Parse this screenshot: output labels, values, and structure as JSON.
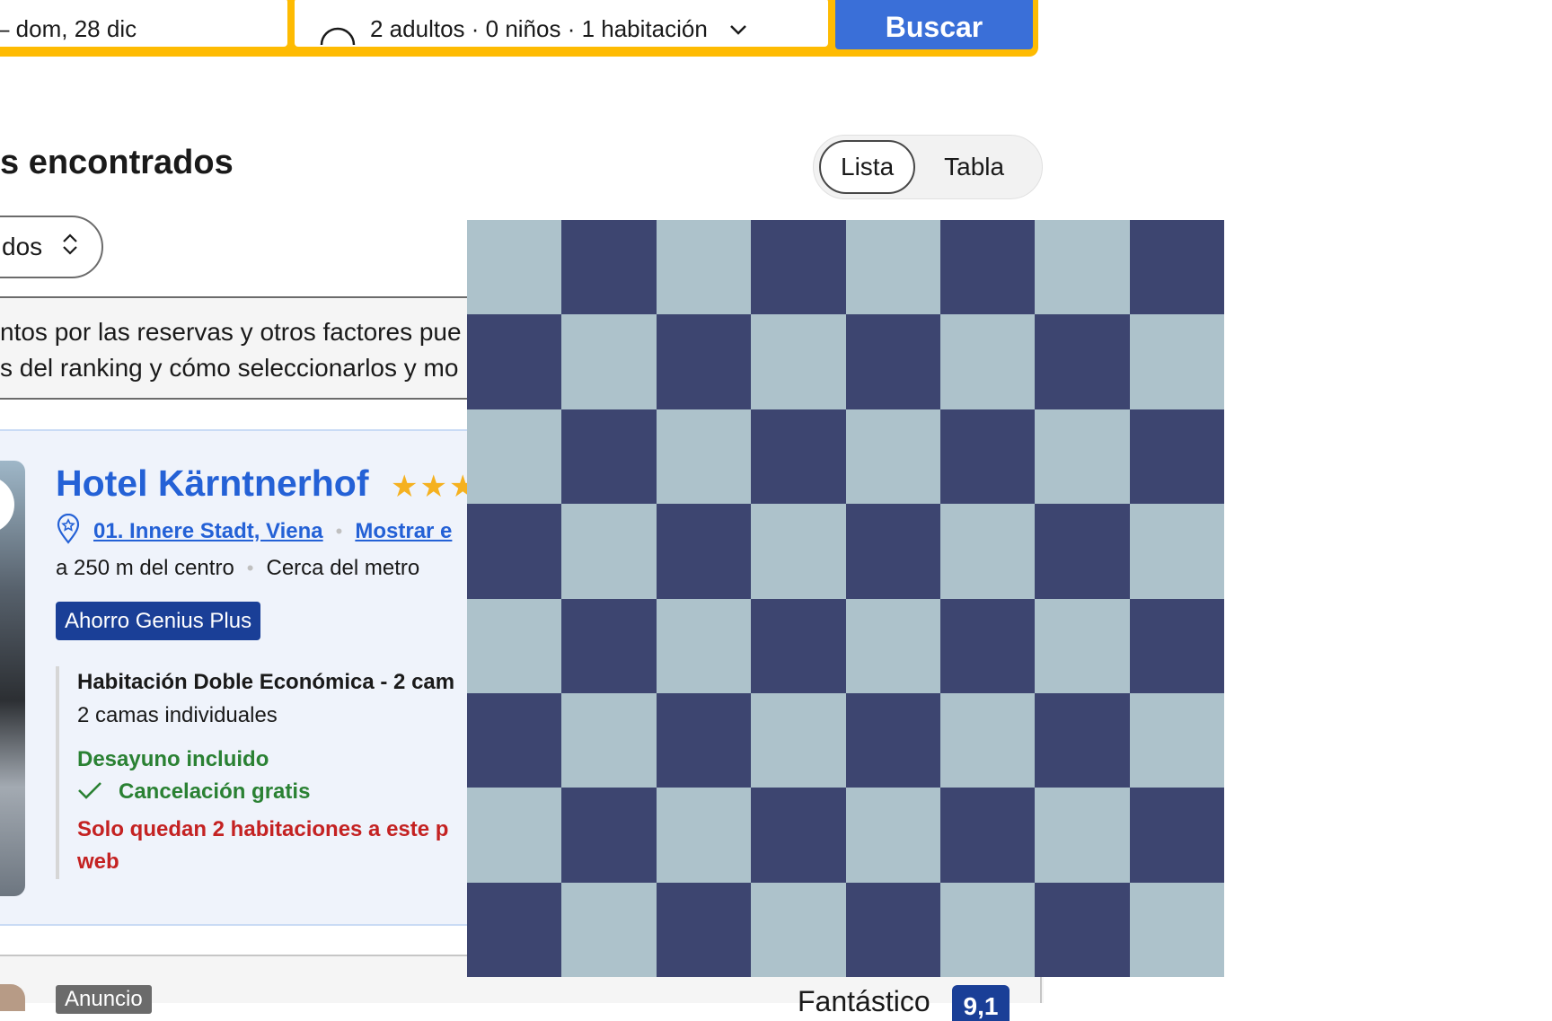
{
  "search": {
    "dates_value": "– dom, 28 dic",
    "guests_value": "2 adultos · 0 niños · 1 habitación",
    "search_button": "Buscar"
  },
  "results": {
    "title_fragment": "s encontrados",
    "view_toggle": {
      "list_label": "Lista",
      "table_label": "Tabla"
    },
    "sort_label_fragment": "dos",
    "info_line1": "ntos por las reservas y otros factores pue",
    "info_line2": "s del ranking y cómo seleccionarlos y mo"
  },
  "hotel": {
    "name": "Hotel Kärntnerhof",
    "stars": "★★★",
    "location_link": "01. Innere Stadt, Viena",
    "map_link_fragment": "Mostrar e",
    "distance": "a 250 m del centro",
    "metro": "Cerca del metro",
    "genius_badge": "Ahorro Genius Plus",
    "room_title": "Habitación Doble Económica - 2 cam",
    "room_beds": "2 camas individuales",
    "breakfast": "Desayuno incluido",
    "cancellation": "Cancelación gratis",
    "scarcity_line1": "Solo quedan 2 habitaciones a este p",
    "scarcity_line2": "web"
  },
  "next_card": {
    "ad_badge": "Anuncio",
    "score_word": "Fantástico",
    "score_value": "9,1"
  },
  "overlay": {
    "checkerboard": {
      "rows": 8,
      "cols": 8,
      "light_color": "#adc2cb",
      "dark_color": "#3d4570"
    }
  },
  "colors": {
    "brand_yellow": "#febb02",
    "primary_blue": "#3a6fd8",
    "link_blue": "#2461d6",
    "genius_navy": "#1a3f97",
    "success_green": "#2a8133",
    "alert_red": "#c42222"
  }
}
